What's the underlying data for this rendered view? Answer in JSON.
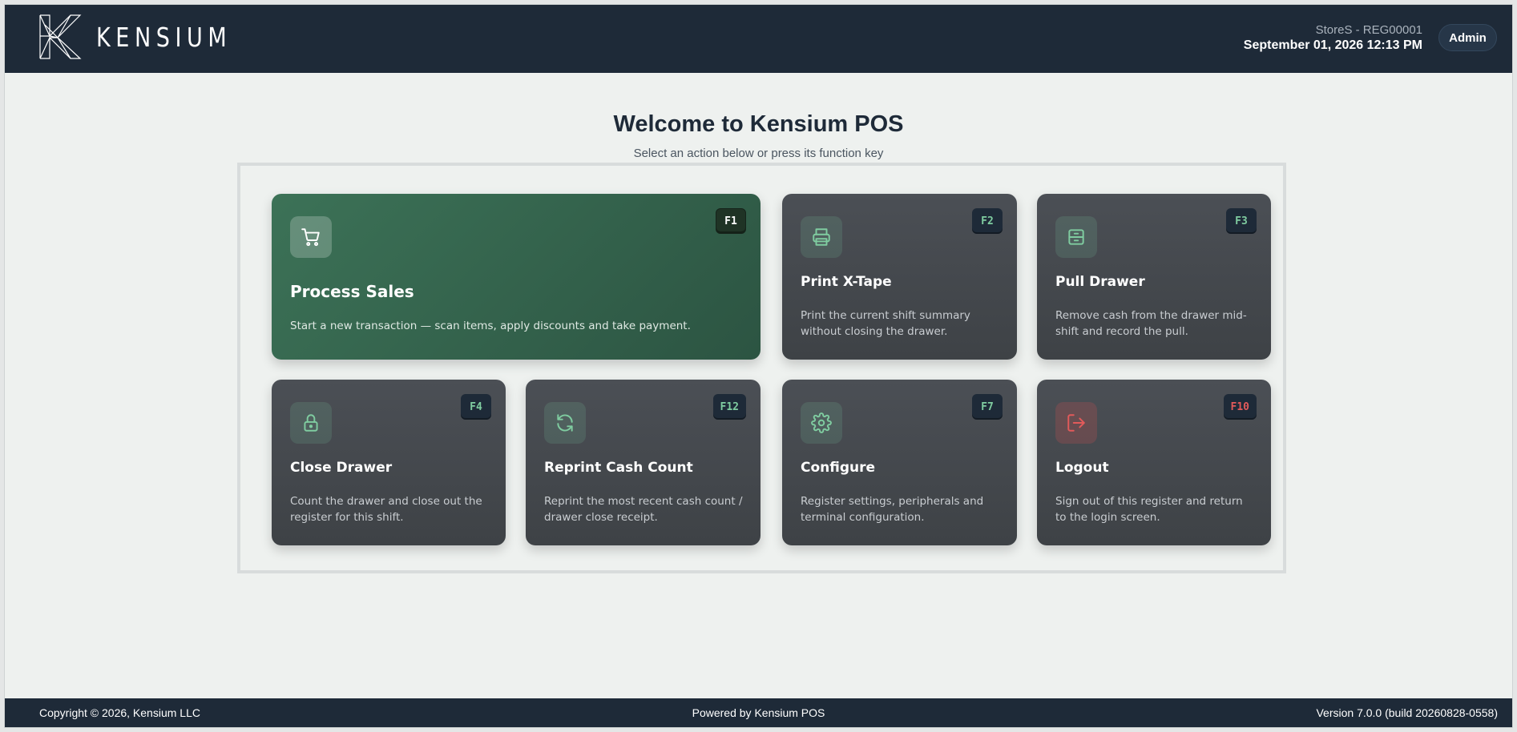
{
  "header": {
    "logo_text": "KENSIUM",
    "store_register": "StoreS - REG00001",
    "datetime": "September 01, 2026 12:13 PM",
    "user_button": "Admin"
  },
  "welcome": {
    "title": "Welcome to Kensium POS",
    "subtitle": "Select an action below or press its function key"
  },
  "cards": [
    {
      "title": "Process Sales",
      "key": "F1",
      "icon": "shopping-cart-icon",
      "description": "Start a new transaction — scan items, apply discounts and take payment."
    },
    {
      "title": "Print X-Tape",
      "key": "F2",
      "icon": "printer-icon",
      "description": "Print the current shift summary without closing the drawer."
    },
    {
      "title": "Pull Drawer",
      "key": "F3",
      "icon": "drawer-icon",
      "description": "Remove cash from the drawer mid-shift and record the pull."
    },
    {
      "title": "Close Drawer",
      "key": "F4",
      "icon": "lock-icon",
      "description": "Count the drawer and close out the register for this shift."
    },
    {
      "title": "Reprint Cash Count",
      "key": "F12",
      "icon": "refresh-icon",
      "description": "Reprint the most recent cash count / drawer close receipt."
    },
    {
      "title": "Configure",
      "key": "F7",
      "icon": "gear-icon",
      "description": "Register settings, peripherals and terminal configuration."
    },
    {
      "title": "Logout",
      "key": "F10",
      "icon": "logout-icon",
      "description": "Sign out of this register and return to the login screen."
    }
  ],
  "footer": {
    "copyright": "Copyright © 2026, Kensium LLC",
    "powered_by": "Powered by Kensium POS",
    "version": "Version 7.0.0 (build 20260828-0558)"
  },
  "colors": {
    "header_bg": "#1e2a38",
    "primary_card": "#3c7257",
    "accent_green": "#7fcca0",
    "danger_red": "#e25a5a"
  }
}
